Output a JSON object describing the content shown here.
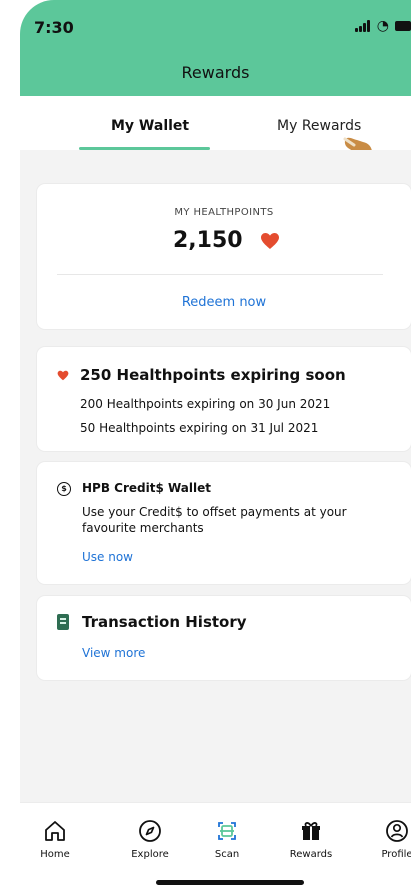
{
  "status_bar": {
    "time": "7:30"
  },
  "header": {
    "title": "Rewards",
    "background_color": "#5cc79a"
  },
  "tabs": [
    {
      "label": "My Wallet",
      "active": true
    },
    {
      "label": "My Rewards",
      "active": false
    }
  ],
  "healthpoints": {
    "label": "MY HEALTHPOINTS",
    "value": "2,150",
    "redeem_label": "Redeem now",
    "icon": "heart-icon"
  },
  "expiring": {
    "title": "250 Healthpoints expiring soon",
    "lines": [
      "200 Healthpoints expiring on 30 Jun 2021",
      "50 Healthpoints expiring on 31 Jul 2021"
    ],
    "icon": "heart-icon"
  },
  "wallet": {
    "icon_text": "$",
    "title": "HPB Credit$ Wallet",
    "description": "Use your Credit$ to offset payments at your favourite merchants",
    "link": "Use now",
    "icon": "dollar-circle-icon"
  },
  "transactions": {
    "title": "Transaction History",
    "link": "View more",
    "icon": "receipt-icon"
  },
  "bottom_nav": [
    {
      "label": "Home",
      "icon": "home-icon"
    },
    {
      "label": "Explore",
      "icon": "compass-icon"
    },
    {
      "label": "Scan",
      "icon": "scan-icon"
    },
    {
      "label": "Rewards",
      "icon": "gift-icon"
    },
    {
      "label": "Profile",
      "icon": "profile-icon"
    }
  ],
  "colors": {
    "accent": "#5cc79a",
    "link": "#1f73d6",
    "heart": "#e44c2f"
  }
}
